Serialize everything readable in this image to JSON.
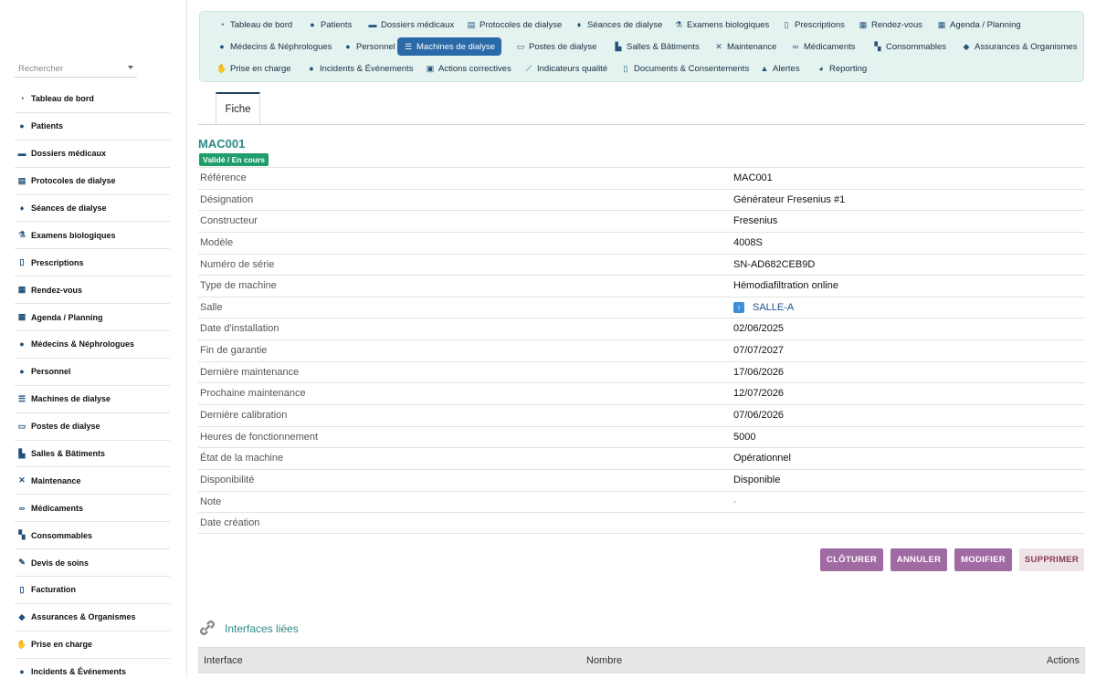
{
  "sidebar": {
    "search_placeholder": "Rechercher",
    "items": [
      {
        "label": "Tableau de bord",
        "icon": "dashboard-icon",
        "glyph": "◔"
      },
      {
        "label": "Patients",
        "icon": "user-icon",
        "glyph": "●"
      },
      {
        "label": "Dossiers médicaux",
        "icon": "folder-icon",
        "glyph": "▬"
      },
      {
        "label": "Protocoles de dialyse",
        "icon": "clipboard-icon",
        "glyph": "▤"
      },
      {
        "label": "Séances de dialyse",
        "icon": "drop-icon",
        "glyph": "♦"
      },
      {
        "label": "Examens biologiques",
        "icon": "flask-icon",
        "glyph": "⚗"
      },
      {
        "label": "Prescriptions",
        "icon": "file-icon",
        "glyph": "▯"
      },
      {
        "label": "Rendez-vous",
        "icon": "calendar-check-icon",
        "glyph": "▦"
      },
      {
        "label": "Agenda / Planning",
        "icon": "calendar-icon",
        "glyph": "▦"
      },
      {
        "label": "Médecins & Néphrologues",
        "icon": "doctor-icon",
        "glyph": "●"
      },
      {
        "label": "Personnel",
        "icon": "staff-icon",
        "glyph": "●"
      },
      {
        "label": "Machines de dialyse",
        "icon": "machine-icon",
        "glyph": "☰"
      },
      {
        "label": "Postes de dialyse",
        "icon": "bed-icon",
        "glyph": "▭"
      },
      {
        "label": "Salles & Bâtiments",
        "icon": "building-icon",
        "glyph": "▙"
      },
      {
        "label": "Maintenance",
        "icon": "tools-icon",
        "glyph": "✕"
      },
      {
        "label": "Médicaments",
        "icon": "pills-icon",
        "glyph": "∞"
      },
      {
        "label": "Consommables",
        "icon": "boxes-icon",
        "glyph": "▚"
      },
      {
        "label": "Devis de soins",
        "icon": "quote-icon",
        "glyph": "✎"
      },
      {
        "label": "Facturation",
        "icon": "invoice-icon",
        "glyph": "▯"
      },
      {
        "label": "Assurances & Organismes",
        "icon": "shield-icon",
        "glyph": "◆"
      },
      {
        "label": "Prise en charge",
        "icon": "hand-icon",
        "glyph": "✋"
      },
      {
        "label": "Incidents & Événements",
        "icon": "alert-circle-icon",
        "glyph": "●"
      }
    ]
  },
  "topnav": {
    "rows": [
      [
        {
          "label": "Tableau de bord",
          "icon": "dashboard-icon",
          "glyph": "◔"
        },
        {
          "label": "Patients",
          "icon": "user-icon",
          "glyph": "●"
        },
        {
          "label": "Dossiers médicaux",
          "icon": "folder-icon",
          "glyph": "▬"
        },
        {
          "label": "Protocoles de dialyse",
          "icon": "clipboard-icon",
          "glyph": "▤"
        },
        {
          "label": "Séances de dialyse",
          "icon": "drop-icon",
          "glyph": "♦"
        },
        {
          "label": "Examens biologiques",
          "icon": "flask-icon",
          "glyph": "⚗"
        },
        {
          "label": "Prescriptions",
          "icon": "file-icon",
          "glyph": "▯"
        },
        {
          "label": "Rendez-vous",
          "icon": "calendar-check-icon",
          "glyph": "▦"
        },
        {
          "label": "Agenda / Planning",
          "icon": "calendar-icon",
          "glyph": "▦"
        }
      ],
      [
        {
          "label": "Médecins & Néphrologues",
          "icon": "doctor-icon",
          "glyph": "●"
        },
        {
          "label": "Personnel",
          "icon": "staff-icon",
          "glyph": "●"
        },
        {
          "label": "Machines de dialyse",
          "icon": "machine-icon",
          "glyph": "☰",
          "active": true
        },
        {
          "label": "Postes de dialyse",
          "icon": "bed-icon",
          "glyph": "▭"
        },
        {
          "label": "Salles & Bâtiments",
          "icon": "building-icon",
          "glyph": "▙"
        },
        {
          "label": "Maintenance",
          "icon": "tools-icon",
          "glyph": "✕"
        },
        {
          "label": "Médicaments",
          "icon": "pills-icon",
          "glyph": "∞"
        },
        {
          "label": "Consommables",
          "icon": "boxes-icon",
          "glyph": "▚"
        },
        {
          "label": "Assurances & Organismes",
          "icon": "shield-icon",
          "glyph": "◆"
        }
      ],
      [
        {
          "label": "Prise en charge",
          "icon": "hand-icon",
          "glyph": "✋"
        },
        {
          "label": "Incidents & Événements",
          "icon": "alert-circle-icon",
          "glyph": "●"
        },
        {
          "label": "Actions correctives",
          "icon": "check-file-icon",
          "glyph": "▣"
        },
        {
          "label": "Indicateurs qualité",
          "icon": "line-chart-icon",
          "glyph": "⟋"
        },
        {
          "label": "Documents & Consentements",
          "icon": "document-icon",
          "glyph": "▯"
        },
        {
          "label": "Alertes",
          "icon": "warning-icon",
          "glyph": "▲"
        },
        {
          "label": "Reporting",
          "icon": "pie-chart-icon",
          "glyph": "◕"
        }
      ]
    ]
  },
  "tabs": {
    "fiche": "Fiche"
  },
  "record": {
    "title": "MAC001",
    "status_badge": "Validé / En cours",
    "fields": [
      {
        "label": "Référence",
        "value": "MAC001"
      },
      {
        "label": "Désignation",
        "value": "Générateur Fresenius #1"
      },
      {
        "label": "Constructeur",
        "value": "Fresenius"
      },
      {
        "label": "Modèle",
        "value": "4008S"
      },
      {
        "label": "Numéro de série",
        "value": "SN-AD682CEB9D"
      },
      {
        "label": "Type de machine",
        "value": "Hémodiafiltration online"
      },
      {
        "label": "Salle",
        "value": "SALLE-A",
        "link": true
      },
      {
        "label": "Date d'installation",
        "value": "02/06/2025"
      },
      {
        "label": "Fin de garantie",
        "value": "07/07/2027"
      },
      {
        "label": "Dernière maintenance",
        "value": "17/06/2026"
      },
      {
        "label": "Prochaine maintenance",
        "value": "12/07/2026"
      },
      {
        "label": "Dernière calibration",
        "value": "07/06/2026"
      },
      {
        "label": "Heures de fonctionnement",
        "value": "5000"
      },
      {
        "label": "État de la machine",
        "value": "Opérationnel"
      },
      {
        "label": "Disponibilité",
        "value": "Disponible"
      },
      {
        "label": "Note",
        "value": "-",
        "muted": true
      },
      {
        "label": "Date création",
        "value": ""
      }
    ]
  },
  "actions": {
    "cloturer": "CLÔTURER",
    "annuler": "ANNULER",
    "modifier": "MODIFIER",
    "supprimer": "SUPPRIMER"
  },
  "linked": {
    "title": "Interfaces liées",
    "columns": {
      "interface": "Interface",
      "nombre": "Nombre",
      "actions": "Actions"
    }
  },
  "colors": {
    "accent_teal": "#2a8a86",
    "active_nav": "#2b6aa8",
    "badge_green": "#1e9e6a",
    "button_purple": "#a06aa3",
    "nav_bg": "#e4f3ef"
  }
}
